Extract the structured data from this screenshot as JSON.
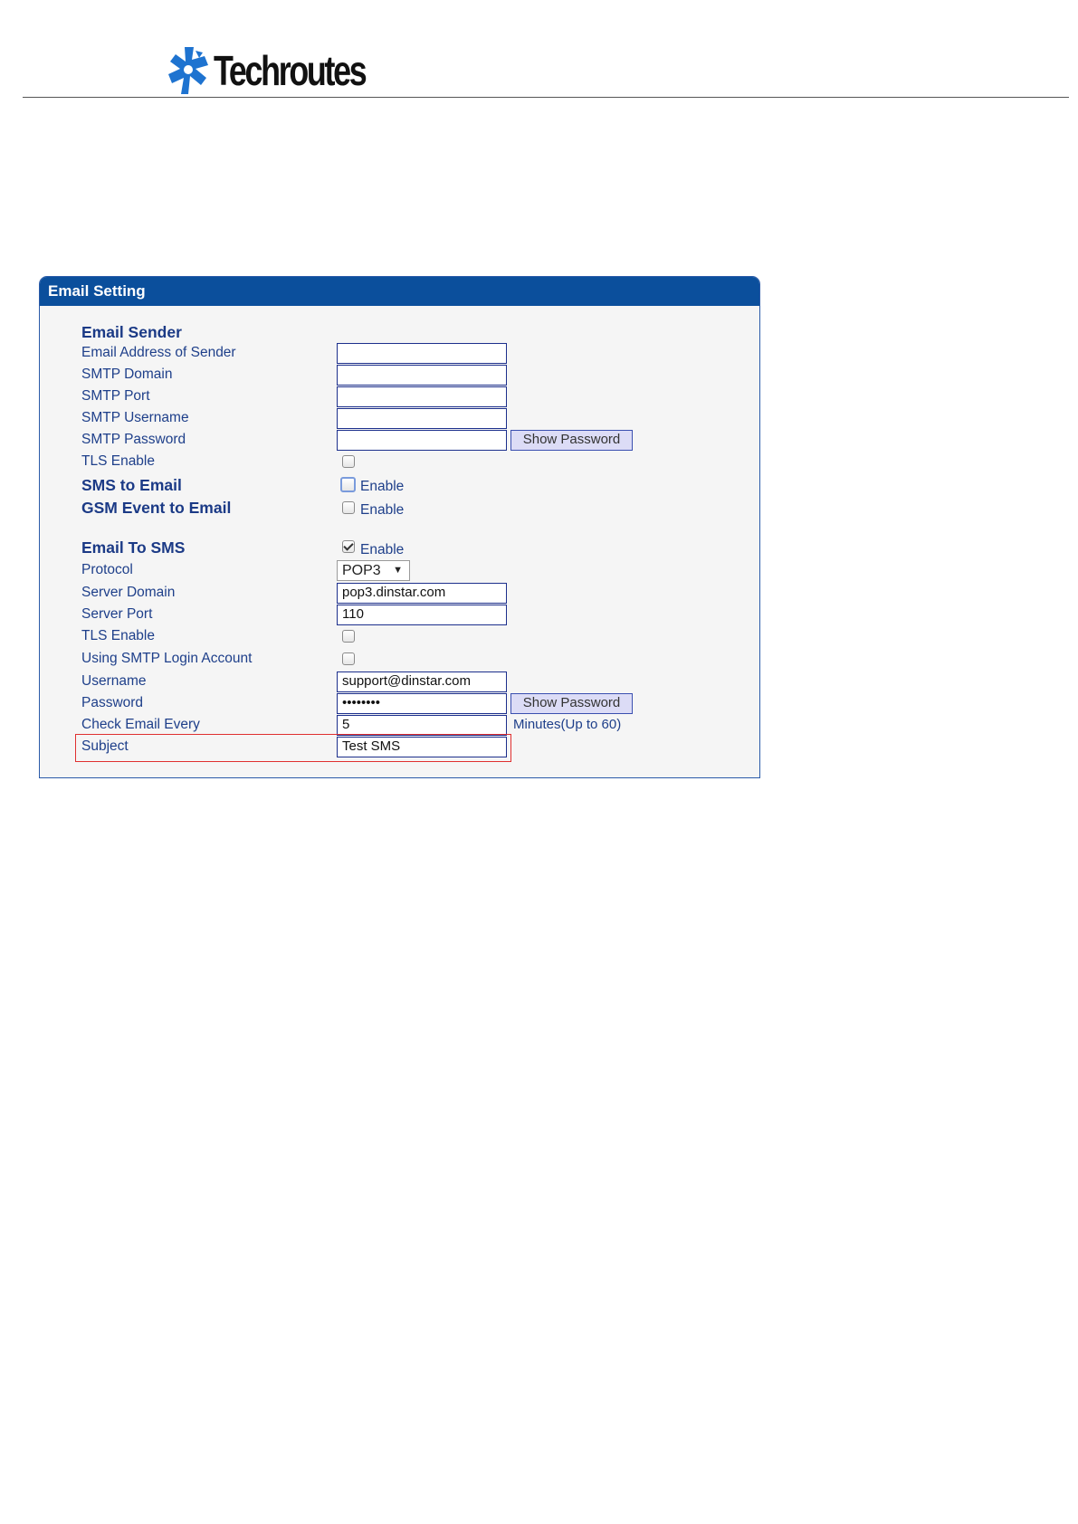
{
  "header": {
    "brand": "Techroutes",
    "logo_icon": "techroutes-cross-logo-icon",
    "brand_color": "#1e73d0"
  },
  "panel": {
    "title": "Email Setting",
    "header_color": "#0b4f9c"
  },
  "email_sender": {
    "section_title": "Email Sender",
    "address_label": "Email Address of Sender",
    "address_value": "",
    "domain_label": "SMTP Domain",
    "domain_value": "",
    "port_label": "SMTP Port",
    "port_value": "",
    "username_label": "SMTP Username",
    "username_value": "",
    "password_label": "SMTP Password",
    "password_value": "",
    "show_password": "Show Password",
    "tls_label": "TLS Enable",
    "tls_checked": false
  },
  "sms_to_email": {
    "label": "SMS to Email",
    "option": "Enable",
    "checked": false
  },
  "gsm_event_to_email": {
    "label": "GSM Event to Email",
    "option": "Enable",
    "checked": false
  },
  "email_to_sms": {
    "section_title": "Email To SMS",
    "option": "Enable",
    "checked": true,
    "protocol_label": "Protocol",
    "protocol_value": "POP3",
    "protocol_arrow": "▼",
    "server_domain_label": "Server Domain",
    "server_domain_value": "pop3.dinstar.com",
    "server_port_label": "Server Port",
    "server_port_value": "110",
    "tls_label": "TLS Enable",
    "tls_checked": false,
    "smtp_login_label": "Using SMTP Login Account",
    "smtp_login_checked": false,
    "username_label": "Username",
    "username_value": "support@dinstar.com",
    "password_label": "Password",
    "password_value": "••••••••",
    "show_password": "Show Password",
    "check_every_label": "Check Email Every",
    "check_every_value": "5",
    "check_every_hint": "Minutes(Up to 60)",
    "subject_label": "Subject",
    "subject_value": "Test SMS"
  }
}
